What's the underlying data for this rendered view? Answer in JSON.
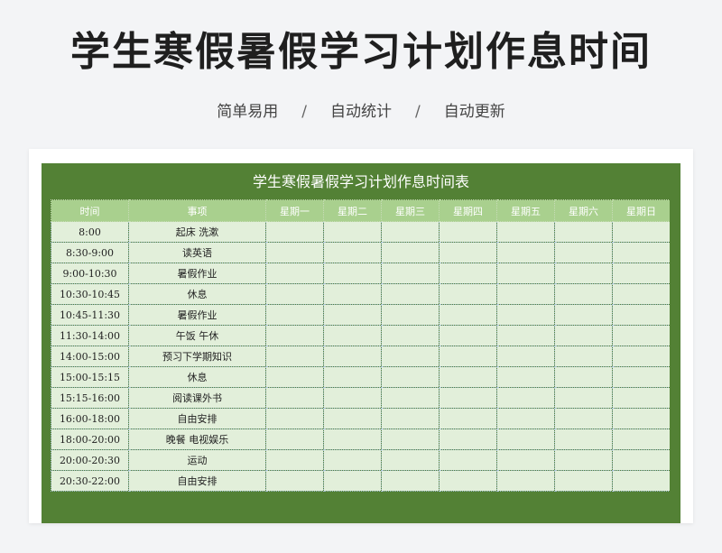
{
  "header": {
    "title": "学生寒假暑假学习计划作息时间",
    "features": [
      "简单易用",
      "自动统计",
      "自动更新"
    ],
    "separator": "/"
  },
  "sheet": {
    "title": "学生寒假暑假学习计划作息时间表",
    "columns": [
      "时间",
      "事项",
      "星期一",
      "星期二",
      "星期三",
      "星期四",
      "星期五",
      "星期六",
      "星期日"
    ],
    "rows": [
      {
        "time": "8:00",
        "item": "起床 洗漱"
      },
      {
        "time": "8:30-9:00",
        "item": "读英语"
      },
      {
        "time": "9:00-10:30",
        "item": "暑假作业"
      },
      {
        "time": "10:30-10:45",
        "item": "休息"
      },
      {
        "time": "10:45-11:30",
        "item": "暑假作业"
      },
      {
        "time": "11:30-14:00",
        "item": "午饭 午休"
      },
      {
        "time": "14:00-15:00",
        "item": "预习下学期知识"
      },
      {
        "time": "15:00-15:15",
        "item": "休息"
      },
      {
        "time": "15:15-16:00",
        "item": "阅读课外书"
      },
      {
        "time": "16:00-18:00",
        "item": "自由安排"
      },
      {
        "time": "18:00-20:00",
        "item": "晚餐 电视娱乐"
      },
      {
        "time": "20:00-20:30",
        "item": "运动"
      },
      {
        "time": "20:30-22:00",
        "item": "自由安排"
      }
    ]
  },
  "colors": {
    "sheet_green": "#538135",
    "header_green": "#a9d08e",
    "cell_green": "#e2efda"
  }
}
